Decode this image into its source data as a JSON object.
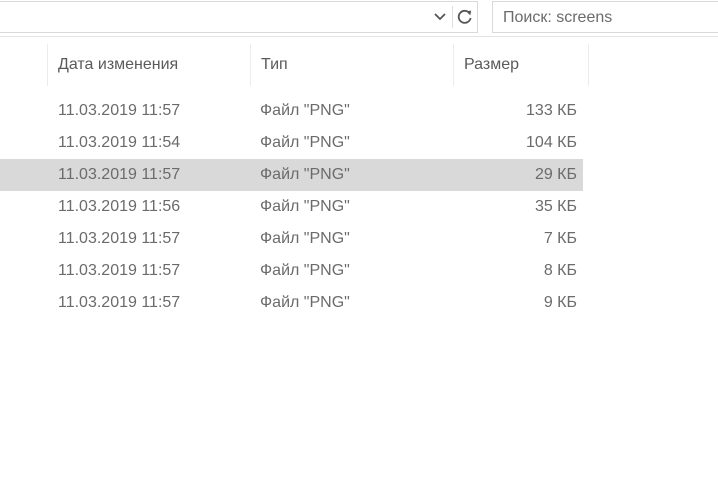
{
  "toolbar": {
    "dropdown_icon": "chevron-down-icon",
    "refresh_icon": "refresh-icon",
    "search_placeholder": "Поиск: screens"
  },
  "columns": {
    "date": "Дата изменения",
    "type": "Тип",
    "size": "Размер"
  },
  "selected_row_index": 2,
  "files": [
    {
      "date": "11.03.2019 11:57",
      "type": "Файл \"PNG\"",
      "size": "133 КБ"
    },
    {
      "date": "11.03.2019 11:54",
      "type": "Файл \"PNG\"",
      "size": "104 КБ"
    },
    {
      "date": "11.03.2019 11:57",
      "type": "Файл \"PNG\"",
      "size": "29 КБ"
    },
    {
      "date": "11.03.2019 11:56",
      "type": "Файл \"PNG\"",
      "size": "35 КБ"
    },
    {
      "date": "11.03.2019 11:57",
      "type": "Файл \"PNG\"",
      "size": "7 КБ"
    },
    {
      "date": "11.03.2019 11:57",
      "type": "Файл \"PNG\"",
      "size": "8 КБ"
    },
    {
      "date": "11.03.2019 11:57",
      "type": "Файл \"PNG\"",
      "size": "9 КБ"
    }
  ],
  "colors": {
    "selection": "#d9d9d9",
    "text": "#6b6b6b"
  }
}
